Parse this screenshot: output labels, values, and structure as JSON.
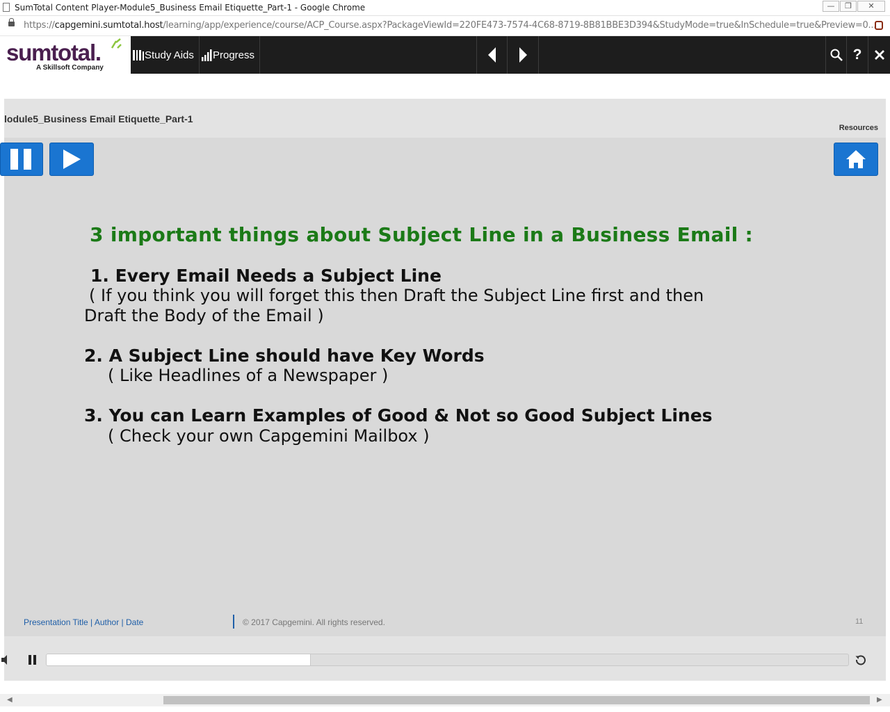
{
  "browser": {
    "window_title": "SumTotal Content Player-Module5_Business Email Etiquette_Part-1 - Google Chrome",
    "url_scheme": "https://",
    "url_host": "capgemini.sumtotal.host",
    "url_path": "/learning/app/experience/course/ACP_Course.aspx?PackageViewId=220FE473-7574-4C68-8719-8B81BBE3D394&StudyMode=true&InSchedule=true&Preview=0...",
    "window_controls": [
      "minimize",
      "restore",
      "close"
    ]
  },
  "toolbar": {
    "logo_text": "sumtotal.",
    "logo_tagline": "A Skillsoft Company",
    "study_aids_label": "Study Aids",
    "progress_label": "Progress",
    "icons": [
      "study-aids-icon",
      "progress-icon",
      "previous-icon",
      "next-icon",
      "search-icon",
      "help-icon",
      "close-icon"
    ]
  },
  "player": {
    "breadcrumb": "lodule5_Business Email Etiquette_Part-1",
    "resources_label": "Resources"
  },
  "slide": {
    "title": "3 important things about Subject Line in a Business Email :",
    "points": [
      {
        "heading": "1. Every Email Needs a Subject Line",
        "note_line1": "( If you think you will forget this then Draft the Subject Line first and then",
        "note_line2": "Draft the Body of the Email )"
      },
      {
        "heading": "2. A Subject Line should have Key Words",
        "note": "( Like Headlines of a Newspaper )"
      },
      {
        "heading": "3. You can Learn Examples of Good & Not so Good Subject Lines",
        "note": "( Check your own Capgemini Mailbox )"
      }
    ],
    "footer_left": "Presentation Title | Author | Date",
    "footer_center": "© 2017 Capgemini. All rights reserved.",
    "page_number": "11"
  },
  "controls": {
    "playback_progress": 0.33
  },
  "colors": {
    "toolbar_bg": "#1d1d1d",
    "brand_purple": "#4a1f4f",
    "brand_green": "#8cc63f",
    "button_blue": "#1a75d1",
    "title_green": "#1b7a17",
    "footer_blue": "#1f5fa8"
  }
}
